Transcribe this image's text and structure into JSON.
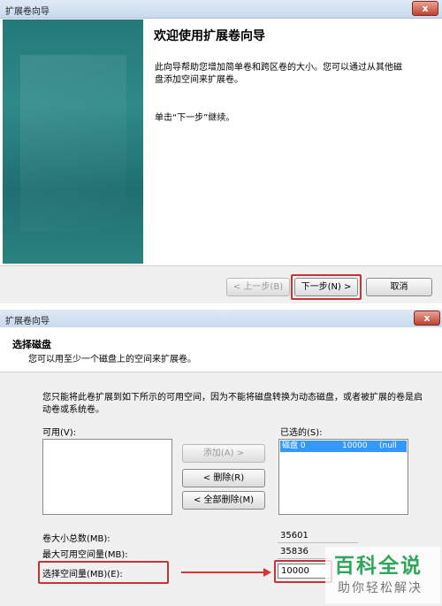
{
  "wizard1": {
    "title": "扩展卷向导",
    "close_glyph": "x",
    "heading": "欢迎使用扩展卷向导",
    "description": "此向导帮助您增加简单卷和跨区卷的大小。您可以通过从其他磁盘添加空间来扩展卷。",
    "instruction": "单击“下一步”继续。",
    "buttons": {
      "back": "< 上一步(B)",
      "next": "下一步(N) >",
      "cancel": "取消"
    }
  },
  "wizard2": {
    "title": "扩展卷向导",
    "close_glyph": "x",
    "header_title": "选择磁盘",
    "header_subtitle": "您可以用至少一个磁盘上的空间来扩展卷。",
    "description": "您只能将此卷扩展到如下所示的可用空间，因为不能将磁盘转换为动态磁盘，或者被扩展的卷是启动卷或系统卷。",
    "available_label": "可用(V):",
    "selected_label": "已选的(S):",
    "selected_items": [
      {
        "disk": "磁盘 0",
        "size": "10000",
        "note": "(null"
      }
    ],
    "buttons": {
      "add": "添加(A) >",
      "remove": "< 删除(R)",
      "remove_all": "< 全部删除(M)"
    },
    "total_label": "卷大小总数(MB):",
    "total_value": "35601",
    "max_label": "最大可用空间量(MB):",
    "max_value": "35836",
    "select_label": "选择空间量(MB)(E):",
    "select_value": "10000"
  },
  "watermark": {
    "big": "百科全说",
    "small": "助你轻松解决"
  },
  "colors": {
    "side_panel": "#237979",
    "highlight_box": "#c8323a",
    "selection": "#3399ff",
    "watermark_green": "#2fa65a"
  }
}
